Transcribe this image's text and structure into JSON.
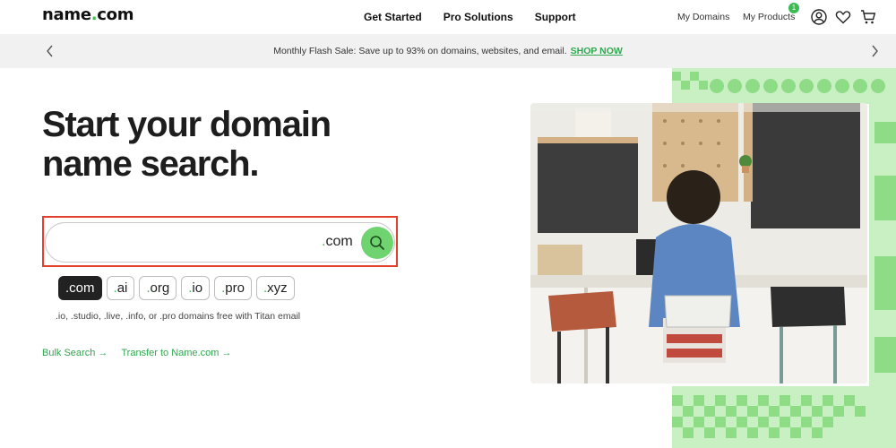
{
  "header": {
    "logo_name": "name",
    "logo_dot": ".",
    "logo_tld": "com",
    "nav": [
      "Get Started",
      "Pro Solutions",
      "Support"
    ],
    "my_domains": "My Domains",
    "my_products": "My Products",
    "cart_badge": "1",
    "icons": [
      "account-icon",
      "heart-icon",
      "cart-icon"
    ]
  },
  "promo": {
    "text": "Monthly Flash Sale: Save up to 93% on domains, websites, and email.",
    "cta": "SHOP NOW"
  },
  "hero": {
    "title_line1": "Start your domain",
    "title_line2": "name search."
  },
  "search": {
    "value": "",
    "placeholder": "",
    "suffix_dot": ".",
    "suffix": "com"
  },
  "tlds": [
    {
      "dot": ".",
      "name": "com",
      "active": true
    },
    {
      "dot": ".",
      "name": "ai",
      "active": false
    },
    {
      "dot": ".",
      "name": "org",
      "active": false
    },
    {
      "dot": ".",
      "name": "io",
      "active": false
    },
    {
      "dot": ".",
      "name": "pro",
      "active": false
    },
    {
      "dot": ".",
      "name": "xyz",
      "active": false
    }
  ],
  "tld_note": ".io, .studio, .live, .info, or .pro domains free with Titan email",
  "links": {
    "bulk": "Bulk Search →",
    "transfer": "Transfer to Name.com →"
  },
  "colors": {
    "brand_green": "#3cba54",
    "search_button": "#6fd36f",
    "highlight_border": "#e2402c",
    "deco_green": "#b7ecb0"
  }
}
